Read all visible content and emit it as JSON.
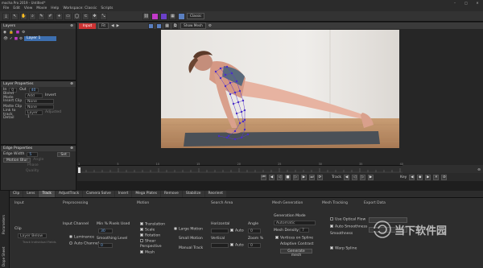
{
  "app": {
    "title": "mocha Pro 2019 - Untitled*",
    "window_controls": [
      "–",
      "□",
      "✕"
    ]
  },
  "menubar": [
    "File",
    "Edit",
    "View",
    "Movie",
    "Help",
    "Workspace: Classic",
    "Scripts"
  ],
  "toolbar": {
    "workspace": "Classic"
  },
  "layers_panel": {
    "title": "Layers",
    "layer_name": "Layer 1"
  },
  "layer_props": {
    "title": "Layer Properties",
    "in_label": "In",
    "in_value": "0",
    "out_label": "Out",
    "out_value": "40",
    "blend_label": "Blend Mode",
    "blend_value": "Add",
    "invert_label": "Invert",
    "insert_clip_label": "Insert Clip",
    "insert_clip_value": "None",
    "matte_clip_label": "Matte Clip",
    "matte_clip_value": "None",
    "link_label": "Link to track",
    "link_value": "Layer 1",
    "adjusted_label": "Adjusted",
    "detail_label": "Detail"
  },
  "edge_props": {
    "title": "Edge Properties",
    "edge_width_label": "Edge Width",
    "edge_width_value": "5",
    "set_label": "Set",
    "motion_blur_label": "Motion Blur",
    "angle_label": "Angle",
    "phase_label": "Phase",
    "quality_label": "Quality"
  },
  "viewer": {
    "tab": "Input",
    "zoom": "Fit",
    "view_mode": "Show Mesh"
  },
  "timeline": {
    "ticks": [
      "1",
      "5",
      "10",
      "15",
      "20",
      "25",
      "30",
      "35",
      "40"
    ],
    "track_label": "Track",
    "key_label": "Key"
  },
  "bottom_tabs": [
    "Clip",
    "Lens",
    "Track",
    "AdjustTrack",
    "Camera Solve",
    "Insert",
    "Mega Plates",
    "Remove",
    "Stabilize",
    "Reorient"
  ],
  "side_tabs": [
    "Parameters",
    "Dope Sheet"
  ],
  "params": {
    "input_title": "Input",
    "clip_label": "Clip",
    "clip_value": "Layer Below",
    "track_individual": "Track Individual Fields",
    "pre_title": "Preprocessing",
    "input_channel": "Input Channel",
    "luminance": "Luminance",
    "auto_channel": "Auto Channel",
    "min_pixels": "Min % Pixels Used",
    "min_pixels_value": "30",
    "smoothing": "Smoothing Level",
    "smoothing_value": "0",
    "motion_title": "Motion",
    "motion": [
      "Translation",
      "Scale",
      "Rotation",
      "Shear",
      "Perspective",
      "Mesh"
    ],
    "large_motion": "Large Motion",
    "small_motion": "Small Motion",
    "manual_track": "Manual Track",
    "search_title": "Search Area",
    "horizontal": "Horizontal",
    "vertical": "Vertical",
    "angle": "Angle",
    "angle_value": "0",
    "zoom": "Zoom %",
    "zoom_value": "0",
    "auto": "Auto",
    "mesh_title": "Mesh Generation",
    "gen_mode": "Generation Mode",
    "gen_value": "Automatic",
    "mesh_density": "Mesh Density",
    "mesh_density_value": "7",
    "vertices_spline": "Vertices on Spline",
    "adaptive_contrast": "Adaptive Contrast",
    "gen_button": "Generate mesh",
    "mtrack_title": "Mesh Tracking",
    "use_optical": "Use Optical Flow",
    "auto_smooth": "Auto Smoothness",
    "smoothness": "Smoothness",
    "warp_spline": "Warp Spline",
    "export_title": "Export Data",
    "watermark": "当下软件园"
  }
}
